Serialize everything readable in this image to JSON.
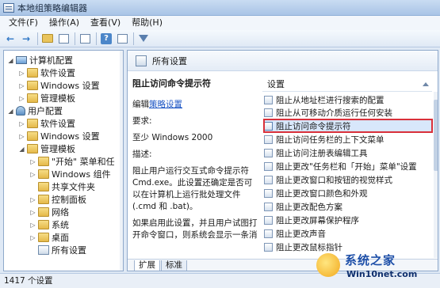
{
  "window": {
    "title": "本地组策略编辑器"
  },
  "menu": [
    "文件(F)",
    "操作(A)",
    "查看(V)",
    "帮助(H)"
  ],
  "toolbar": {
    "icons": [
      "back-arrow-icon",
      "forward-arrow-icon",
      "up-folder-icon",
      "console-tree-icon",
      "export-icon",
      "help-icon",
      "properties-icon",
      "filter-icon"
    ]
  },
  "tree": {
    "items": [
      {
        "label": "计算机配置",
        "icon": "computer-icon",
        "expanded": true
      },
      {
        "label": "软件设置",
        "icon": "folder-icon"
      },
      {
        "label": "Windows 设置",
        "icon": "folder-icon"
      },
      {
        "label": "管理模板",
        "icon": "folder-icon"
      },
      {
        "label": "用户配置",
        "icon": "user-icon",
        "expanded": true
      },
      {
        "label": "软件设置",
        "icon": "folder-icon"
      },
      {
        "label": "Windows 设置",
        "icon": "folder-icon"
      },
      {
        "label": "管理模板",
        "icon": "folder-icon",
        "expanded": true
      },
      {
        "label": "\"开始\" 菜单和任",
        "icon": "folder-icon"
      },
      {
        "label": "Windows 组件",
        "icon": "folder-icon"
      },
      {
        "label": "共享文件夹",
        "icon": "folder-icon"
      },
      {
        "label": "控制面板",
        "icon": "folder-icon"
      },
      {
        "label": "网络",
        "icon": "folder-icon"
      },
      {
        "label": "系统",
        "icon": "folder-icon"
      },
      {
        "label": "桌面",
        "icon": "folder-icon"
      },
      {
        "label": "所有设置",
        "icon": "settings-icon"
      }
    ]
  },
  "main": {
    "header_title": "所有设置",
    "description": {
      "heading": "阻止访问命令提示符",
      "edit_prefix": "编辑",
      "edit_link": "策略设置",
      "requirements_label": "要求:",
      "requirements_value": "至少 Windows 2000",
      "description_label": "描述:",
      "description_text": "阻止用户运行交互式命令提示符 Cmd.exe。此设置还确定是否可以在计算机上运行批处理文件(.cmd 和 .bat)。",
      "description_more": "如果启用此设置，并且用户试图打开命令窗口，则系统会显示一条消"
    },
    "settings_column_header": "设置",
    "settings": [
      "阻止从地址栏进行搜索的配置",
      "阻止从可移动介质运行任何安装",
      "阻止访问命令提示符",
      "阻止访问任务栏的上下文菜单",
      "阻止访问注册表编辑工具",
      "阻止更改\"任务栏和「开始」菜单\"设置",
      "阻止更改窗口和按钮的视觉样式",
      "阻止更改窗口颜色和外观",
      "阻止更改配色方案",
      "阻止更改屏幕保护程序",
      "阻止更改声音",
      "阻止更改鼠标指针"
    ],
    "selected_index": 2,
    "tabs": [
      "扩展",
      "标准"
    ]
  },
  "status": {
    "text": "1417 个设置"
  },
  "watermark": {
    "line1": "系统之家",
    "line2": "Win10net.com"
  },
  "colors": {
    "selection_border": "#d9303a",
    "selection_fill": "#d8e7fb",
    "link": "#1b55c4"
  }
}
